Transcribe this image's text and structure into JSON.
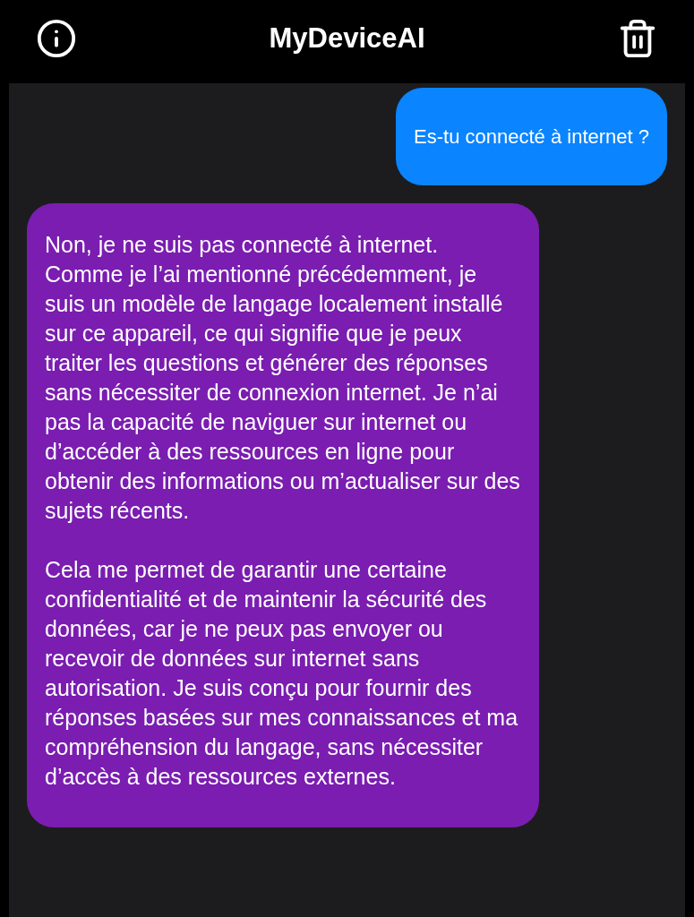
{
  "header": {
    "title": "MyDeviceAI"
  },
  "messages": [
    {
      "kind": "user",
      "paragraphs": [
        "Es-tu connecté à internet ?"
      ]
    },
    {
      "kind": "assistant",
      "paragraphs": [
        "Non, je ne suis pas connecté à internet. Comme je l’ai mentionné précédemment, je suis un modèle de langage localement installé sur ce appareil, ce qui signifie que je peux traiter les questions et générer des réponses sans nécessiter de connexion internet. Je n’ai pas la capacité de naviguer sur internet ou d’accéder à des ressources en ligne pour obtenir des informations ou m’actualiser sur des sujets récents.",
        "Cela me permet de garantir une certaine confidentialité et de maintenir la sécurité des données, car je ne peux pas envoyer ou recevoir de données sur internet sans autorisation. Je suis conçu pour fournir des réponses basées sur mes connaissances et ma compréhension du langage, sans nécessiter d’accès à des ressources externes."
      ]
    }
  ]
}
